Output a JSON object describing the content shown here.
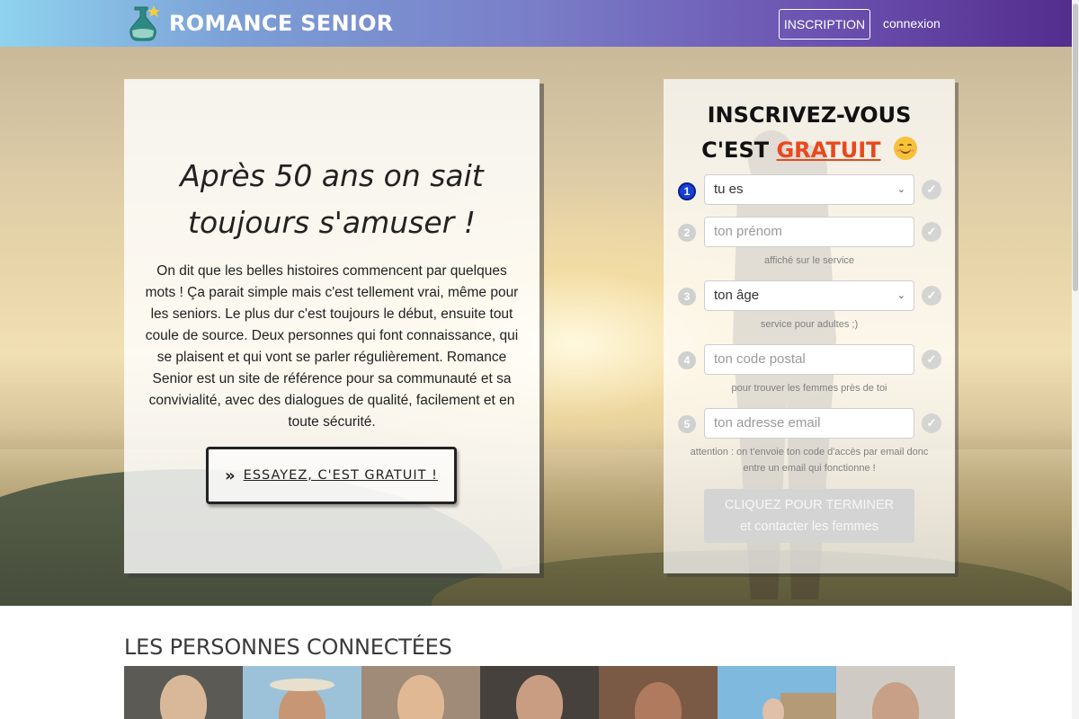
{
  "header": {
    "brand": "ROMANCE SENIOR",
    "logo_icon": "potion-bottle-star-icon",
    "inscription_label": "INSCRIPTION",
    "connexion_label": "connexion"
  },
  "hero": {
    "title_line1": "Après 50 ans on sait",
    "title_line2": "toujours s'amuser !",
    "text": "On dit que les belles histoires commencent par quelques mots ! Ça parait simple mais c'est tellement vrai, même pour les seniors. Le plus dur c'est toujours le début, ensuite tout coule de source. Deux personnes qui font connaissance, qui se plaisent et qui vont se parler régulièrement. Romance Senior est un site de référence pour sa communauté et sa convivialité, avec des dialogues de qualité, facilement et en toute sécurité.",
    "cta_label": "ESSAYEZ, C'EST GRATUIT !",
    "cta_icon": "double-chevron-right-icon"
  },
  "form": {
    "title_line1": "INSCRIVEZ-VOUS",
    "title_prefix": "C'EST",
    "title_highlight": "GRATUIT",
    "title_emoji": "smiling-face-icon",
    "accent_color": "#e8491d",
    "steps": [
      {
        "num": "1",
        "value": "tu es",
        "type": "select",
        "hint": ""
      },
      {
        "num": "2",
        "placeholder": "ton prénom",
        "type": "text",
        "hint": "affiché sur le service"
      },
      {
        "num": "3",
        "value": "ton âge",
        "type": "select",
        "hint": "service pour adultes ;)"
      },
      {
        "num": "4",
        "placeholder": "ton code postal",
        "type": "text",
        "hint": "pour trouver les femmes près de toi"
      },
      {
        "num": "5",
        "placeholder": "ton adresse email",
        "type": "text",
        "hint_line1": "attention : on t'envoie ton code d'accès par email donc",
        "hint_line2": "entre un email qui fonctionne !"
      }
    ],
    "submit_line1": "CLIQUEZ POUR TERMINER",
    "submit_line2": "et contacter les femmes"
  },
  "connected": {
    "title": "LES PERSONNES CONNECTÉES"
  }
}
